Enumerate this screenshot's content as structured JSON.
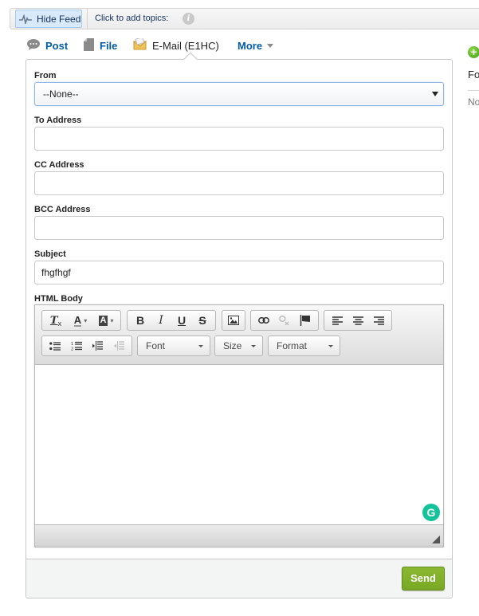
{
  "topbar": {
    "hide_feed_label": "Hide Feed",
    "add_topics_label": "Click to add topics:",
    "info_icon": "i"
  },
  "tabs": [
    {
      "label": "Post",
      "icon": "speech-bubble-icon",
      "active": false
    },
    {
      "label": "File",
      "icon": "file-icon",
      "active": false
    },
    {
      "label": "E-Mail (E1HC)",
      "icon": "envelope-icon",
      "active": true
    },
    {
      "label": "More",
      "icon": "caret-down-icon",
      "active": false
    }
  ],
  "right_panel": {
    "plus_icon": "+",
    "title": "Fo",
    "text": "No"
  },
  "form": {
    "from": {
      "label": "From",
      "value": "--None--"
    },
    "to": {
      "label": "To Address",
      "value": ""
    },
    "cc": {
      "label": "CC Address",
      "value": ""
    },
    "bcc": {
      "label": "BCC Address",
      "value": ""
    },
    "subject": {
      "label": "Subject",
      "value": "fhgfhgf"
    },
    "body": {
      "label": "HTML Body",
      "value": ""
    }
  },
  "editor": {
    "toolbar_row1": [
      [
        "remove-format",
        "text-color",
        "background-color"
      ],
      [
        "bold",
        "italic",
        "underline",
        "strikethrough"
      ],
      [
        "image"
      ],
      [
        "link",
        "unlink",
        "anchor"
      ],
      [
        "align-left",
        "align-center",
        "align-right"
      ]
    ],
    "font_label": "Font",
    "size_label": "Size",
    "format_label": "Format",
    "grammarly_icon": "G"
  },
  "footer": {
    "send_label": "Send"
  },
  "colors": {
    "link": "#015ba7",
    "send_green": "#80b02b",
    "grammarly": "#15c39a"
  }
}
